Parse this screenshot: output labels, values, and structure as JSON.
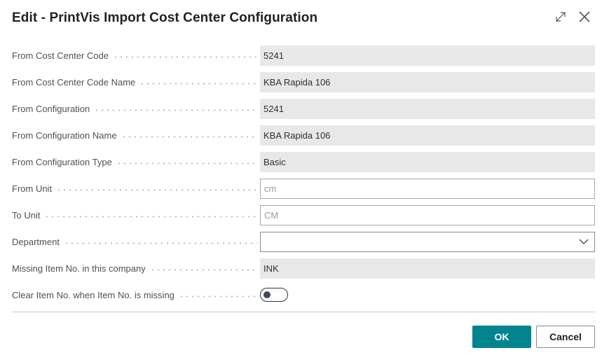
{
  "dialog": {
    "title": "Edit - PrintVis Import Cost Center Configuration",
    "expand_icon": "expand-icon",
    "close_icon": "close-icon"
  },
  "fields": [
    {
      "label": "From Cost Center Code",
      "value": "5241"
    },
    {
      "label": "From Cost Center Code Name",
      "value": "KBA Rapida 106"
    },
    {
      "label": "From Configuration",
      "value": "5241"
    },
    {
      "label": "From Configuration Name",
      "value": "KBA Rapida 106"
    },
    {
      "label": "From Configuration Type",
      "value": "Basic"
    },
    {
      "label": "From Unit",
      "value": "cm"
    },
    {
      "label": "To Unit",
      "value": "CM"
    },
    {
      "label": "Department",
      "value": "",
      "dropdown_icon": "chevron-down-icon"
    },
    {
      "label": "Missing Item No. in this company",
      "value": "INK"
    },
    {
      "label": "Clear Item No. when Item No. is missing",
      "toggle_on": false
    }
  ],
  "buttons": {
    "ok": "OK",
    "cancel": "Cancel"
  },
  "colors": {
    "primary": "#00848e",
    "readonly_bg": "#e8e8e9"
  }
}
